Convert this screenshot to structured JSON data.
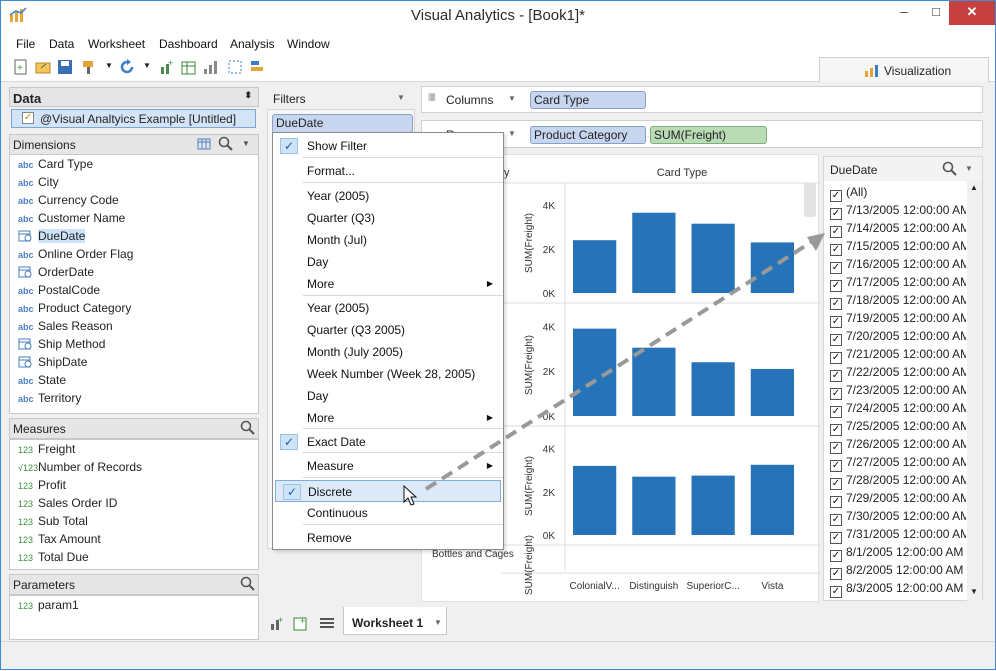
{
  "window": {
    "title": "Visual Analytics - [Book1]*",
    "minimize": "–",
    "maximize": "□",
    "close": "✕"
  },
  "menu": [
    "File",
    "Data",
    "Worksheet",
    "Dashboard",
    "Analysis",
    "Window"
  ],
  "viz_button": "Visualization",
  "data_panel": {
    "title": "Data",
    "source": "@Visual Analtyics Example [Untitled]",
    "dimensions_title": "Dimensions",
    "dimensions": [
      {
        "type": "abc",
        "label": "Card Type"
      },
      {
        "type": "abc",
        "label": "City"
      },
      {
        "type": "abc",
        "label": "Currency Code"
      },
      {
        "type": "abc",
        "label": "Customer Name"
      },
      {
        "type": "date",
        "label": "DueDate"
      },
      {
        "type": "abc",
        "label": "Online Order Flag"
      },
      {
        "type": "date",
        "label": "OrderDate"
      },
      {
        "type": "abc",
        "label": "PostalCode"
      },
      {
        "type": "abc",
        "label": "Product Category"
      },
      {
        "type": "abc",
        "label": "Sales Reason"
      },
      {
        "type": "date",
        "label": "Ship Method"
      },
      {
        "type": "date",
        "label": "ShipDate"
      },
      {
        "type": "abc",
        "label": "State"
      },
      {
        "type": "abc",
        "label": "Territory"
      }
    ],
    "measures_title": "Measures",
    "measures": [
      {
        "type": "123",
        "label": "Freight"
      },
      {
        "type": "√123",
        "label": "Number of Records"
      },
      {
        "type": "123",
        "label": "Profit"
      },
      {
        "type": "123",
        "label": "Sales Order ID"
      },
      {
        "type": "123",
        "label": "Sub Total"
      },
      {
        "type": "123",
        "label": "Tax Amount"
      },
      {
        "type": "123",
        "label": "Total Due"
      }
    ],
    "parameters_title": "Parameters",
    "parameters": [
      {
        "type": "123",
        "label": "param1"
      }
    ]
  },
  "filters": {
    "title": "Filters",
    "pill": "DueDate"
  },
  "shelves": {
    "columns_label": "Columns",
    "columns_pills": [
      "Card Type"
    ],
    "rows_label": "Rows",
    "rows_pills": [
      "Product Category",
      "SUM(Freight)"
    ]
  },
  "context_menu": [
    {
      "label": "Show Filter",
      "checked": true
    },
    {
      "label": "Format..."
    },
    {
      "label": "Year (2005)"
    },
    {
      "label": "Quarter (Q3)"
    },
    {
      "label": "Month (Jul)"
    },
    {
      "label": "Day"
    },
    {
      "label": "More",
      "submenu": true
    },
    {
      "label": "Year (2005)"
    },
    {
      "label": "Quarter (Q3 2005)"
    },
    {
      "label": "Month (July 2005)"
    },
    {
      "label": "Week Number (Week 28, 2005)"
    },
    {
      "label": "Day"
    },
    {
      "label": "More",
      "submenu": true
    },
    {
      "label": "Exact Date",
      "checked": true
    },
    {
      "label": "Measure",
      "submenu": true
    },
    {
      "label": "Discrete",
      "checked": true,
      "highlighted": true
    },
    {
      "label": "Continuous"
    },
    {
      "label": "Remove"
    }
  ],
  "chart_data": {
    "type": "bar",
    "header_left": "y",
    "column_header": "Card Type",
    "categories": [
      "ColonialV...",
      "Distinguish",
      "SuperiorC...",
      "Vista"
    ],
    "ylabel": "SUM(Freight)",
    "yticks": [
      "0K",
      "2K",
      "4K"
    ],
    "ylim": [
      0,
      5000
    ],
    "visible_row_label": "Bottles and Cages",
    "panes": [
      {
        "values": [
          2400,
          3650,
          3150,
          2300
        ]
      },
      {
        "values": [
          3900,
          3050,
          2400,
          2100
        ]
      },
      {
        "values": [
          3200,
          2700,
          2750,
          3250
        ]
      }
    ],
    "bar_color": "#2673b8"
  },
  "due_filter": {
    "title": "DueDate",
    "items": [
      "(All)",
      "7/13/2005 12:00:00 AM",
      "7/14/2005 12:00:00 AM",
      "7/15/2005 12:00:00 AM",
      "7/16/2005 12:00:00 AM",
      "7/17/2005 12:00:00 AM",
      "7/18/2005 12:00:00 AM",
      "7/19/2005 12:00:00 AM",
      "7/20/2005 12:00:00 AM",
      "7/21/2005 12:00:00 AM",
      "7/22/2005 12:00:00 AM",
      "7/23/2005 12:00:00 AM",
      "7/24/2005 12:00:00 AM",
      "7/25/2005 12:00:00 AM",
      "7/26/2005 12:00:00 AM",
      "7/27/2005 12:00:00 AM",
      "7/28/2005 12:00:00 AM",
      "7/29/2005 12:00:00 AM",
      "7/30/2005 12:00:00 AM",
      "7/31/2005 12:00:00 AM",
      "8/1/2005 12:00:00 AM",
      "8/2/2005 12:00:00 AM",
      "8/3/2005 12:00:00 AM"
    ]
  },
  "tabs": {
    "active": "Worksheet 1"
  }
}
